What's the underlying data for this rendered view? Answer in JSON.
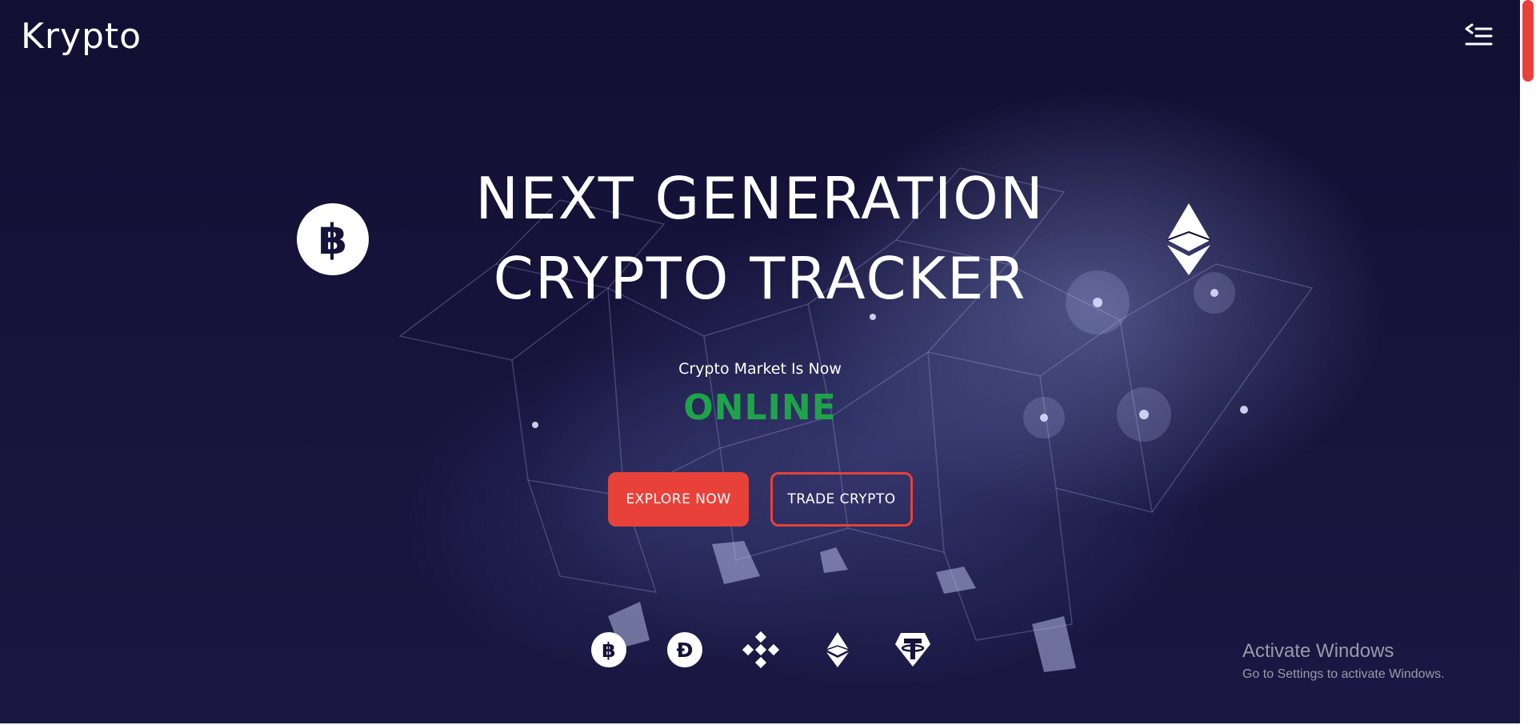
{
  "header": {
    "logo": "Krypto",
    "menu_icon": "menu-collapse-icon"
  },
  "hero": {
    "title_line1": "NEXT GENERATION",
    "title_line2": "CRYPTO TRACKER",
    "subtitle": "Crypto Market Is Now",
    "status": "ONLINE",
    "status_color": "#1fa34a",
    "left_coin_icon": "bitcoin-icon",
    "right_coin_icon": "ethereum-icon"
  },
  "buttons": {
    "explore": "EXPLORE NOW",
    "trade": "TRADE CRYPTO",
    "accent_color": "#e7413a"
  },
  "coin_row": [
    {
      "icon": "bitcoin-icon"
    },
    {
      "icon": "dogecoin-icon"
    },
    {
      "icon": "binance-icon"
    },
    {
      "icon": "ethereum-icon"
    },
    {
      "icon": "tether-icon"
    }
  ],
  "watermark": {
    "title": "Activate Windows",
    "subtitle": "Go to Settings to activate Windows."
  }
}
